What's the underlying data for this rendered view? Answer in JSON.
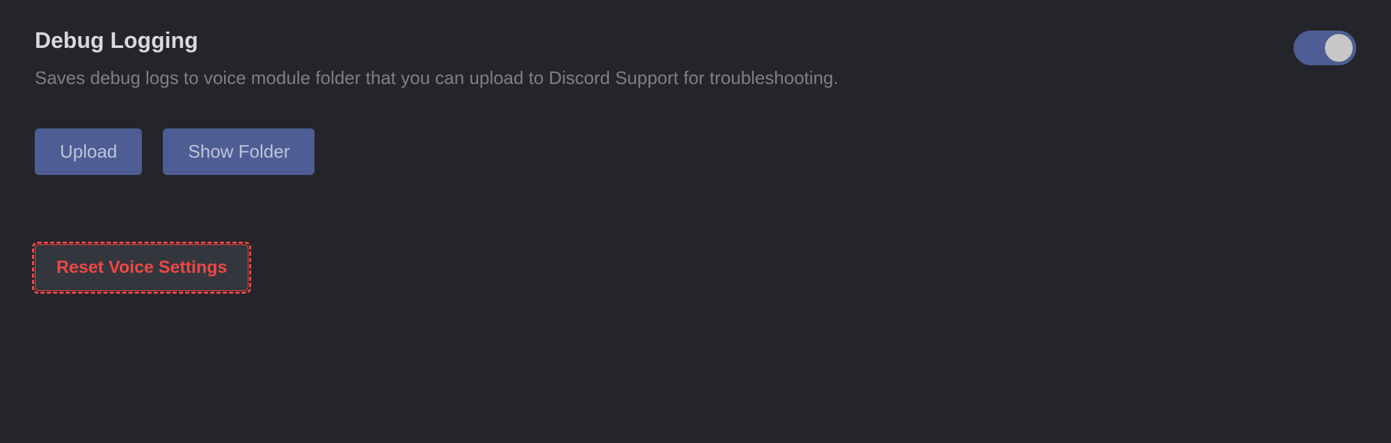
{
  "debug_logging": {
    "title": "Debug Logging",
    "description": "Saves debug logs to voice module folder that you can upload to Discord Support for troubleshooting.",
    "enabled": true,
    "upload_label": "Upload",
    "show_folder_label": "Show Folder"
  },
  "reset": {
    "label": "Reset Voice Settings"
  }
}
